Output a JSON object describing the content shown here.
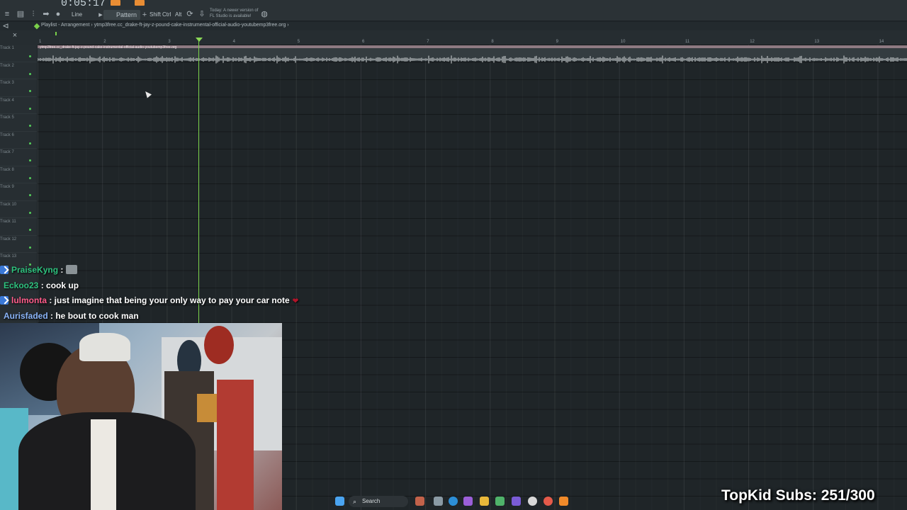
{
  "app": {
    "time_display": "0:05:17",
    "pattern_label": "Pattern 1",
    "snap_mode": "Line",
    "keys": [
      "Shift",
      "Ctrl",
      "Alt"
    ],
    "update_notice": "Today: A newer version of FL Studio is available!"
  },
  "breadcrumb": {
    "text": "Playlist - Arrangement › ytmp3free.cc_drake-ft-jay-z-pound-cake-instrumental-official-audio-youtubemp3free.org ›"
  },
  "ruler": {
    "bars": [
      "1",
      "2",
      "3",
      "4",
      "5",
      "6",
      "7",
      "8",
      "9",
      "10",
      "11",
      "12",
      "13",
      "14"
    ]
  },
  "tracks": [
    "Track 1",
    "Track 2",
    "Track 3",
    "Track 4",
    "Track 5",
    "Track 6",
    "Track 7",
    "Track 8",
    "Track 9",
    "Track 10",
    "Track 11",
    "Track 12",
    "Track 13"
  ],
  "clip": {
    "title": "ytmp3free.cc_drake-ft-jay-z-pound-cake-instrumental-official-audio-youtubemp3free.org"
  },
  "chat": [
    {
      "user": "PraiseKyng",
      "text": "",
      "color": "#2ec27e",
      "badge": true,
      "emote": true
    },
    {
      "user": "Eckoo23",
      "text": " : cook up",
      "color": "#2ec27e",
      "badge": false
    },
    {
      "user": "lulmonta",
      "text": " : just imagine that being your only way to pay your car note",
      "color": "#ff5c8a",
      "badge": true,
      "heart": true
    },
    {
      "user": "Aurisfaded",
      "text": " : he bout to cook man",
      "color": "#8ab4f8",
      "badge": false
    }
  ],
  "taskbar": {
    "search_placeholder": "Search"
  },
  "overlay": {
    "subs_text": "TopKid Subs: 251/300"
  },
  "colors": {
    "playhead": "#7ad04a",
    "clip_header": "#8e7a82",
    "grid_bg": "#1f2528"
  }
}
